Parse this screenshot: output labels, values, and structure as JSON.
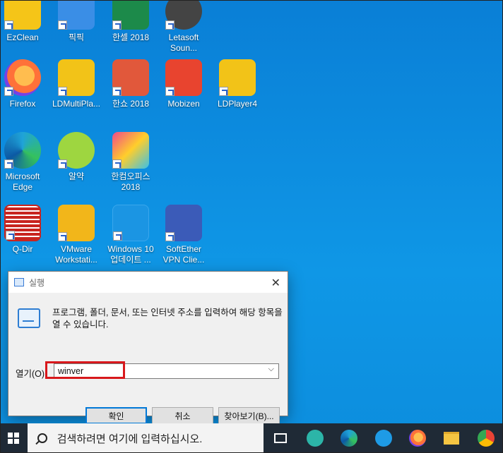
{
  "desktop": {
    "icons": [
      {
        "label": "EzClean",
        "color": "#f5c518"
      },
      {
        "label": "픽픽",
        "color": "#3a8ee6"
      },
      {
        "label": "한셀 2018",
        "color": "#1c8a4a"
      },
      {
        "label": "Letasoft\nSoun...",
        "color": "#444444"
      },
      {
        "label": "Firefox",
        "color": "#ff7139"
      },
      {
        "label": "LDMultiPla...",
        "color": "#f2c318"
      },
      {
        "label": "한쇼 2018",
        "color": "#e1583b"
      },
      {
        "label": "Mobizen",
        "color": "#e8442f"
      },
      {
        "label": "LDPlayer4",
        "color": "#f2c318"
      },
      {
        "label": "Microsoft\nEdge",
        "color": "#1fa3d9"
      },
      {
        "label": "알약",
        "color": "#9ed640"
      },
      {
        "label": "한컴오피스\n2018",
        "color": "#ffffff"
      },
      {
        "label": "Q-Dir",
        "color": "#c8241f"
      },
      {
        "label": "VMware\nWorkstati...",
        "color": "#f2b61a"
      },
      {
        "label": "Windows 10\n업데이트 ...",
        "color": "#2f86d6"
      },
      {
        "label": "SoftEther\nVPN Clie...",
        "color": "#3b5bb8"
      }
    ]
  },
  "dialog": {
    "title": "실행",
    "description": "프로그램, 폴더, 문서, 또는 인터넷 주소를 입력하여 해당 항목을 열 수 있습니다.",
    "open_label": "열기(O):",
    "input_value": "winver",
    "buttons": {
      "ok": "확인",
      "cancel": "취소",
      "browse": "찾아보기(B)..."
    }
  },
  "taskbar": {
    "search_placeholder": "검색하려면 여기에 입력하십시오.",
    "apps": [
      "task-view",
      "mobizen",
      "edge",
      "internet-explorer",
      "firefox",
      "file-explorer",
      "chrome"
    ]
  }
}
